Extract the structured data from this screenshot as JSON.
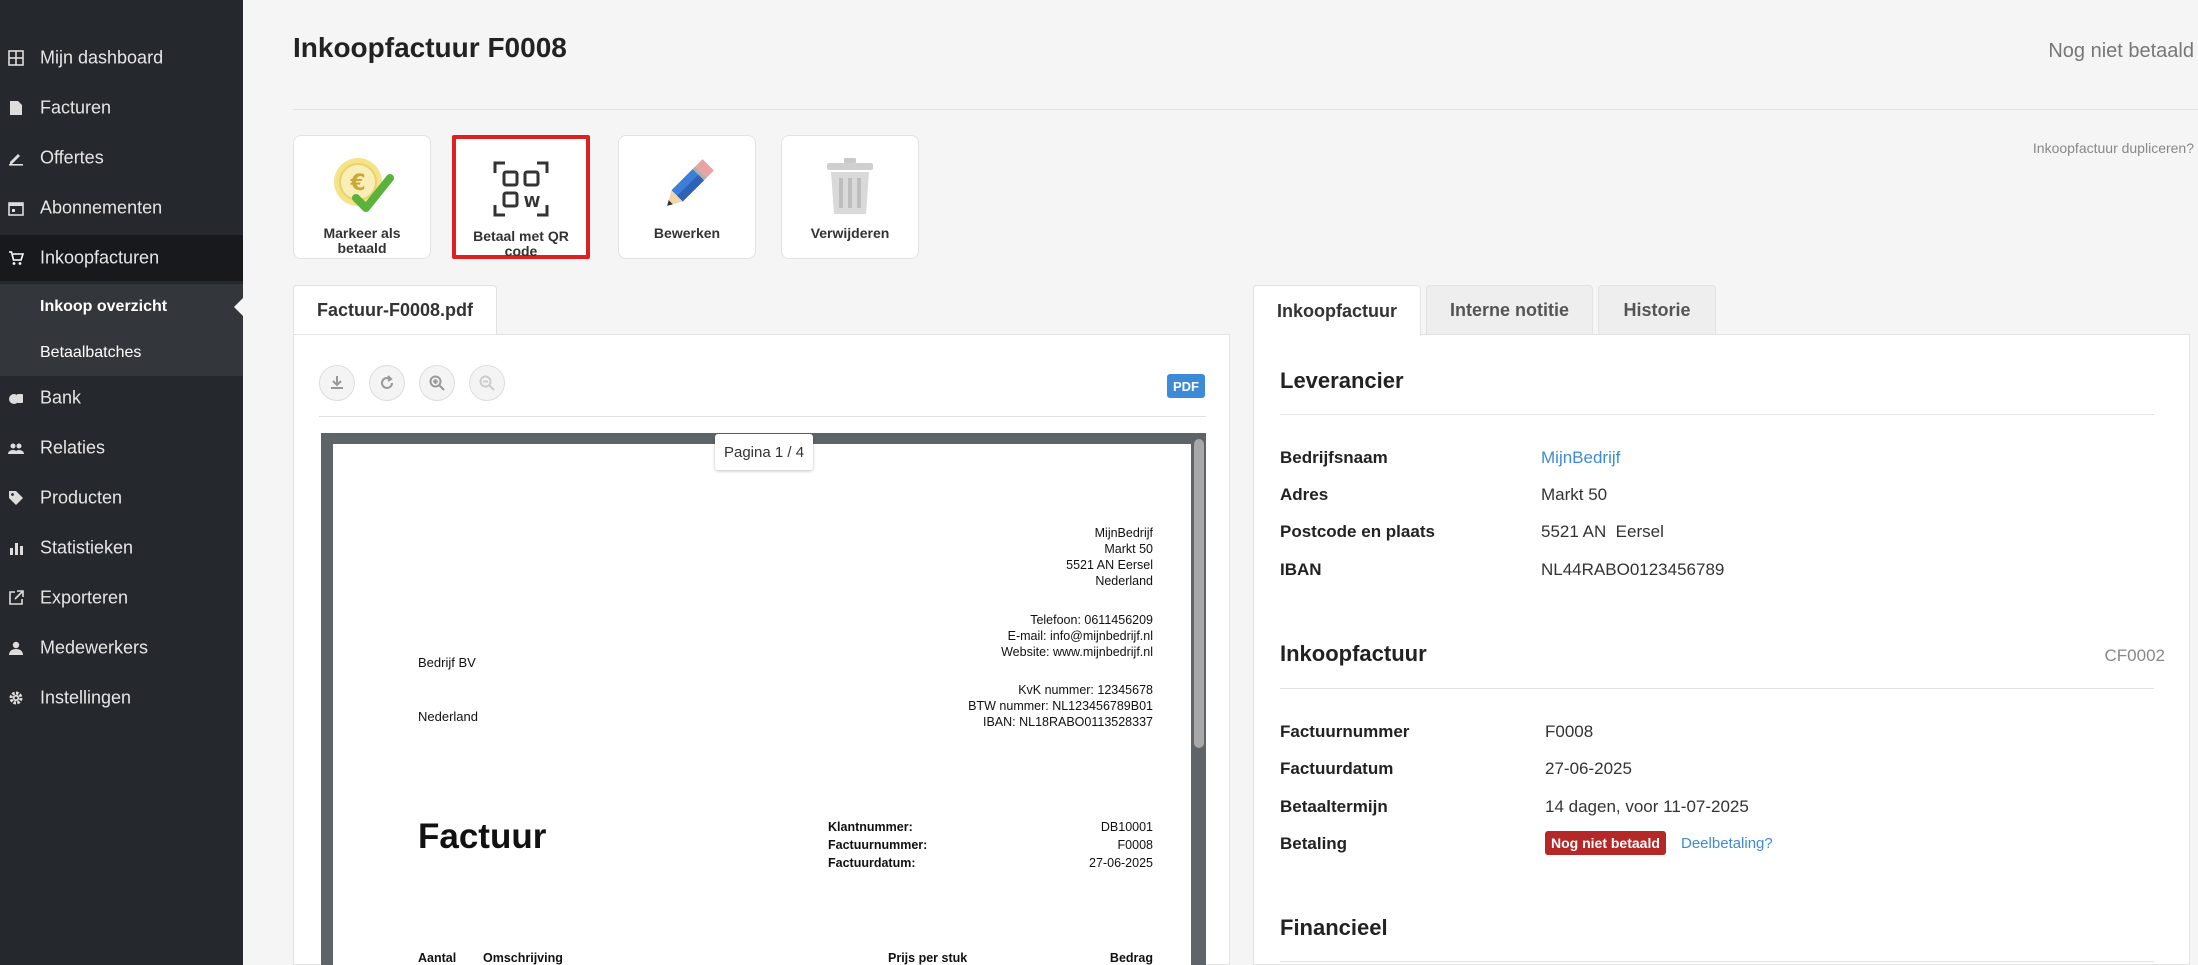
{
  "sidebar": {
    "items": [
      {
        "label": "Mijn dashboard",
        "icon": "grid-icon"
      },
      {
        "label": "Facturen",
        "icon": "document-icon"
      },
      {
        "label": "Offertes",
        "icon": "pencil-icon"
      },
      {
        "label": "Abonnementen",
        "icon": "calendar-icon"
      },
      {
        "label": "Inkoopfacturen",
        "icon": "cart-icon"
      },
      {
        "label": "Bank",
        "icon": "bank-icon"
      },
      {
        "label": "Relaties",
        "icon": "people-icon"
      },
      {
        "label": "Producten",
        "icon": "tag-icon"
      },
      {
        "label": "Statistieken",
        "icon": "bar-chart-icon"
      },
      {
        "label": "Exporteren",
        "icon": "export-icon"
      },
      {
        "label": "Medewerkers",
        "icon": "person-icon"
      },
      {
        "label": "Instellingen",
        "icon": "gear-icon"
      }
    ],
    "subitems": [
      {
        "label": "Inkoop overzicht"
      },
      {
        "label": "Betaalbatches"
      }
    ]
  },
  "header": {
    "title": "Inkoopfactuur F0008",
    "status": "Nog niet betaald",
    "duplicate_link": "Inkoopfactuur dupliceren?"
  },
  "actions": [
    {
      "label": "Markeer als betaald",
      "icon": "euro-check-icon"
    },
    {
      "label": "Betaal met QR code",
      "icon": "qr-code-icon"
    },
    {
      "label": "Bewerken",
      "icon": "pencil-icon"
    },
    {
      "label": "Verwijderen",
      "icon": "trash-icon"
    }
  ],
  "pdf": {
    "tab_label": "Factuur-F0008.pdf",
    "badge": "PDF",
    "page_indicator": "Pagina 1 / 4",
    "document": {
      "sender": [
        "MijnBedrijf",
        "Markt 50",
        "5521 AN Eersel",
        "Nederland"
      ],
      "contact": [
        "Telefoon: 0611456209",
        "E-mail: info@mijnbedrijf.nl",
        "Website: www.mijnbedrijf.nl"
      ],
      "registration": [
        "KvK nummer: 12345678",
        "BTW nummer: NL123456789B01",
        "IBAN: NL18RABO0113528337"
      ],
      "recipient_name": "Bedrijf BV",
      "recipient_country": "Nederland",
      "heading": "Factuur",
      "meta_labels": [
        "Klantnummer:",
        "Factuurnummer:",
        "Factuurdatum:"
      ],
      "meta_values": [
        "DB10001",
        "F0008",
        "27-06-2025"
      ],
      "table_headers": [
        "Aantal",
        "Omschrijving",
        "Prijs per stuk",
        "Bedrag"
      ]
    }
  },
  "tabs": [
    {
      "label": "Inkoopfactuur"
    },
    {
      "label": "Interne notitie"
    },
    {
      "label": "Historie"
    }
  ],
  "supplier": {
    "title": "Leverancier",
    "rows": [
      {
        "key": "Bedrijfsnaam",
        "value": "MijnBedrijf"
      },
      {
        "key": "Adres",
        "value": "Markt 50"
      },
      {
        "key": "Postcode en plaats",
        "value": "5521 AN  Eersel"
      },
      {
        "key": "IBAN",
        "value": "NL44RABO0123456789"
      }
    ]
  },
  "invoice": {
    "title": "Inkoopfactuur",
    "code": "CF0002",
    "rows": [
      {
        "key": "Factuurnummer",
        "value": "F0008"
      },
      {
        "key": "Factuurdatum",
        "value": "27-06-2025"
      },
      {
        "key": "Betaaltermijn",
        "value": "14 dagen, voor 11-07-2025"
      },
      {
        "key": "Betaling",
        "value": "Nog niet betaald"
      }
    ],
    "partial_link": "Deelbetaling?"
  },
  "financial": {
    "title": "Financieel"
  },
  "colors": {
    "sidebar_bg": "#25282d",
    "accent": "#3d8bd8",
    "status_red": "#b52828",
    "highlight": "#e02020"
  }
}
